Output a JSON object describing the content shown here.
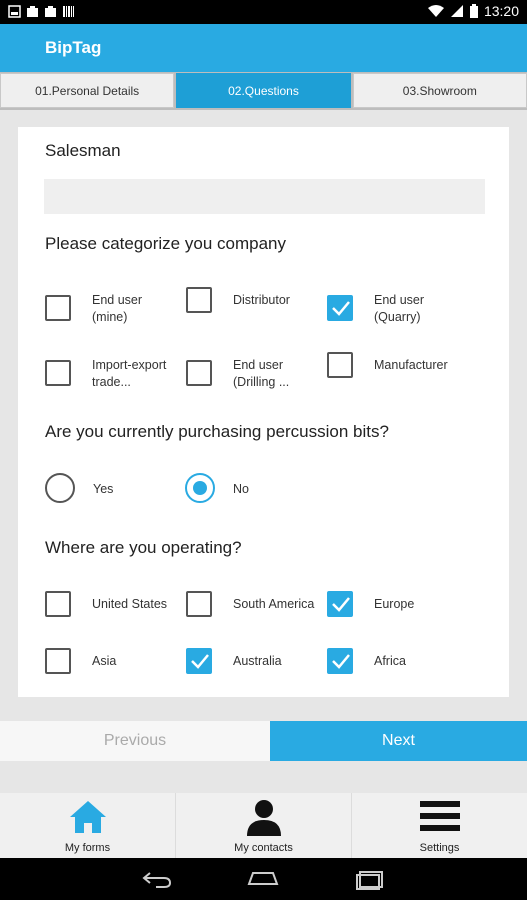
{
  "status_bar": {
    "time": "13:20"
  },
  "app": {
    "title": "BipTag"
  },
  "tabs": [
    {
      "label": "01.Personal Details",
      "active": false
    },
    {
      "label": "02.Questions",
      "active": true
    },
    {
      "label": "03.Showroom",
      "active": false
    }
  ],
  "form": {
    "salesman": {
      "label": "Salesman",
      "value": ""
    },
    "categorize": {
      "label": "Please categorize you company",
      "options": [
        {
          "label": "End user\n(mine)",
          "checked": false
        },
        {
          "label": "Distributor",
          "checked": false
        },
        {
          "label": "End user\n(Quarry)",
          "checked": true
        },
        {
          "label": "Import-export\ntrade...",
          "checked": false
        },
        {
          "label": "End user\n(Drilling ...",
          "checked": false
        },
        {
          "label": "Manufacturer",
          "checked": false
        }
      ]
    },
    "purchasing": {
      "label": "Are you currently purchasing percussion bits?",
      "options": [
        {
          "label": "Yes",
          "selected": false
        },
        {
          "label": "No",
          "selected": true
        }
      ]
    },
    "operating": {
      "label": "Where are you operating?",
      "options": [
        {
          "label": "United States",
          "checked": false
        },
        {
          "label": "South America",
          "checked": false
        },
        {
          "label": "Europe",
          "checked": true
        },
        {
          "label": "Asia",
          "checked": false
        },
        {
          "label": "Australia",
          "checked": true
        },
        {
          "label": "Africa",
          "checked": true
        }
      ]
    }
  },
  "buttons": {
    "previous": "Previous",
    "next": "Next"
  },
  "bottom_nav": [
    {
      "label": "My forms",
      "icon": "home-icon"
    },
    {
      "label": "My contacts",
      "icon": "person-icon"
    },
    {
      "label": "Settings",
      "icon": "menu-icon"
    }
  ],
  "colors": {
    "accent": "#29aae2",
    "tab_active": "#1e9fd6"
  }
}
